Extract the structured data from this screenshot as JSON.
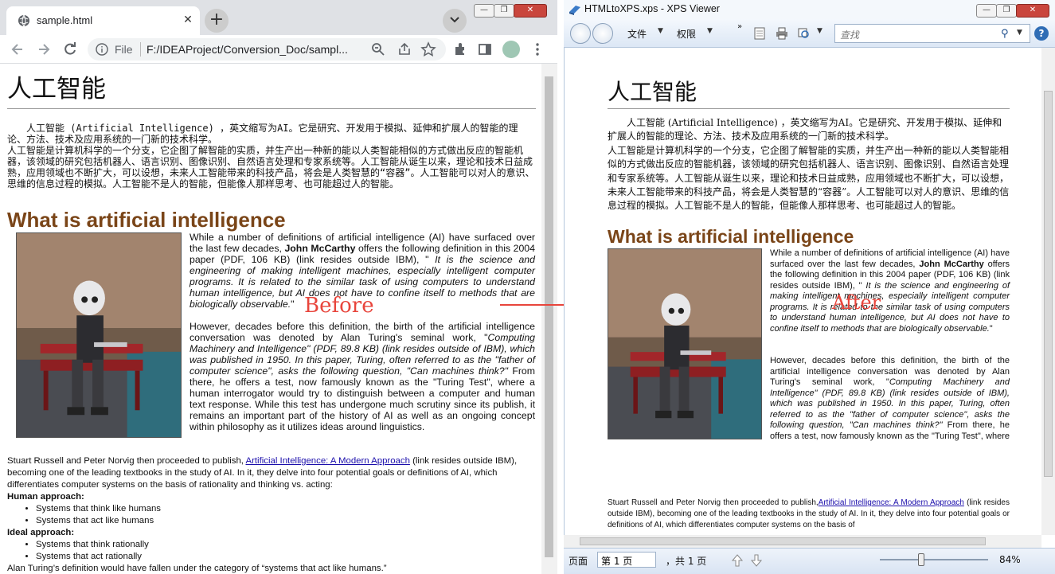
{
  "chrome": {
    "tab_title": "sample.html",
    "new_tab_label": "+",
    "close_tab_label": "✕",
    "protocol": "File",
    "url": "F:/IDEAProject/Conversion_Doc/sampl...",
    "window_buttons": [
      "—",
      "❐",
      "✕"
    ]
  },
  "page": {
    "title": "人工智能",
    "cn_p1": "人工智能 (Artificial Intelligence) ，英文缩写为AI。它是研究、开发用于模拟、延伸和扩展人的智能的理论、方法、技术及应用系统的一门新的技术科学。",
    "cn_p2": "人工智能是计算机科学的一个分支，它企图了解智能的实质，并生产出一种新的能以人类智能相似的方式做出反应的智能机器，该领域的研究包括机器人、语言识别、图像识别、自然语言处理和专家系统等。人工智能从诞生以来，理论和技术日益成熟，应用领域也不断扩大，可以设想，未来人工智能带来的科技产品，将会是人类智慧的“容器”。人工智能可以对人的意识、思维的信息过程的模拟。人工智能不是人的智能，但能像人那样思考、也可能超过人的智能。",
    "heading": "What is artificial intelligence",
    "en_p1_a": "While a number of definitions of artificial intelligence (AI) have surfaced over the last few decades, ",
    "en_p1_name": "John McCarthy",
    "en_p1_b": " offers the following definition in this 2004 paper (PDF, 106 KB) (link resides outside IBM), \"",
    "en_p1_quote": " It is the science and engineering of making intelligent machines, especially intelligent computer programs. It is related to the similar task of using computers to understand human intelligence, but AI does not have to confine itself to methods that are biologically observable.",
    "en_p1_end": "\"",
    "en_p2_a": "However, decades before this definition, the birth of the artificial intelligence conversation was denoted by Alan Turing's seminal work, \"",
    "en_p2_italic": "Computing Machinery and Intelligence\" (PDF, 89.8 KB) (link resides outside of IBM), which was published in 1950. In this paper, Turing, often referred to as the \"father of computer science\", asks the following question, \"Can machines think?\"",
    "en_p2_b": "  From there, he offers a test, now famously known as the \"Turing Test\", where a human interrogator would try to distinguish between a computer and human text response. While this test has undergone much scrutiny since its publish, it remains an important part of the history of AI as well as an ongoing concept within philosophy as it utilizes ideas around linguistics.",
    "en_p3_a": "Stuart Russell and Peter Norvig then proceeded to publish, ",
    "en_p3_link": "Artificial Intelligence: A Modern Approach",
    "en_p3_b": " (link resides outside IBM), becoming one of the leading textbooks in the study of AI. In it, they delve into four potential goals or definitions of AI, which differentiates computer systems on the basis of rationality and thinking vs. acting:",
    "human_approach": "Human approach:",
    "human_items": [
      "Systems that think like humans",
      "Systems that act like humans"
    ],
    "ideal_approach": "Ideal approach:",
    "ideal_items": [
      "Systems that think rationally",
      "Systems that act rationally"
    ],
    "last_line": "Alan Turing’s definition would have fallen under the category of “systems that act like humans.”"
  },
  "annotations": {
    "before": "Before",
    "after": "After",
    "color": "#e8453c"
  },
  "xps": {
    "title": "HTMLtoXPS.xps - XPS Viewer",
    "menu_file": "文件",
    "menu_permissions": "权限",
    "search_placeholder": "查找",
    "help": "?",
    "status_page_label": "页面",
    "status_page_value": "第 1 页",
    "status_total": "，共 1 页",
    "zoom": "84%",
    "en_p3_a": "Stuart Russell and Peter Norvig then proceeded to publish,",
    "en_p3_link": "Artificial Intelligence: A Modern Approach",
    "en_p3_b": " (link resides outside IBM), becoming one of the leading textbooks in the study of AI. In it, they delve into four potential goals or definitions of AI, which differentiates computer systems on the basis of"
  },
  "colors": {
    "heading_brown": "#7a4518",
    "link_blue": "#1a0dab"
  }
}
